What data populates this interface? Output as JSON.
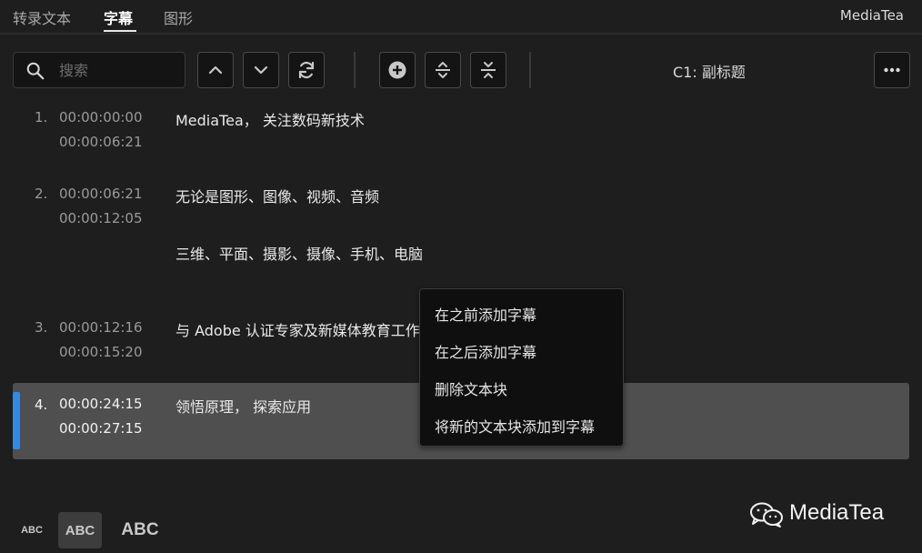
{
  "tabs": [
    {
      "label": "转录文本"
    },
    {
      "label": "字幕"
    },
    {
      "label": "图形"
    }
  ],
  "app_brand": "MediaTea",
  "search": {
    "placeholder": "搜索",
    "value": ""
  },
  "toolbar": {
    "track_label": "C1: 副标题",
    "icons": [
      "chevron-up-icon",
      "chevron-down-icon",
      "refresh-icon",
      "add-circle-icon",
      "split-icon",
      "merge-icon",
      "more-icon"
    ]
  },
  "captions": [
    {
      "num": "1.",
      "start": "00:00:00:00",
      "end": "00:00:06:21",
      "lines": [
        "MediaTea， 关注数码新技术"
      ]
    },
    {
      "num": "2.",
      "start": "00:00:06:21",
      "end": "00:00:12:05",
      "lines": [
        "无论是图形、图像、视频、音频",
        "三维、平面、摄影、摄像、手机、电脑"
      ]
    },
    {
      "num": "3.",
      "start": "00:00:12:16",
      "end": "00:00:15:20",
      "lines": [
        "与 Adobe 认证专家及新媒体教育工作者"
      ]
    },
    {
      "num": "4.",
      "start": "00:00:24:15",
      "end": "00:00:27:15",
      "lines": [
        "领悟原理， 探索应用"
      ],
      "selected": true
    }
  ],
  "context_menu": [
    "在之前添加字幕",
    "在之后添加字幕",
    "删除文本块",
    "将新的文本块添加到字幕"
  ],
  "text_size": {
    "small": "ABC",
    "medium": "ABC",
    "large": "ABC",
    "selected": "medium"
  },
  "watermark": "MediaTea",
  "colors": {
    "accent": "#2d8ceb",
    "background": "#1e1e1e",
    "selected_row": "#4f4f4f"
  }
}
